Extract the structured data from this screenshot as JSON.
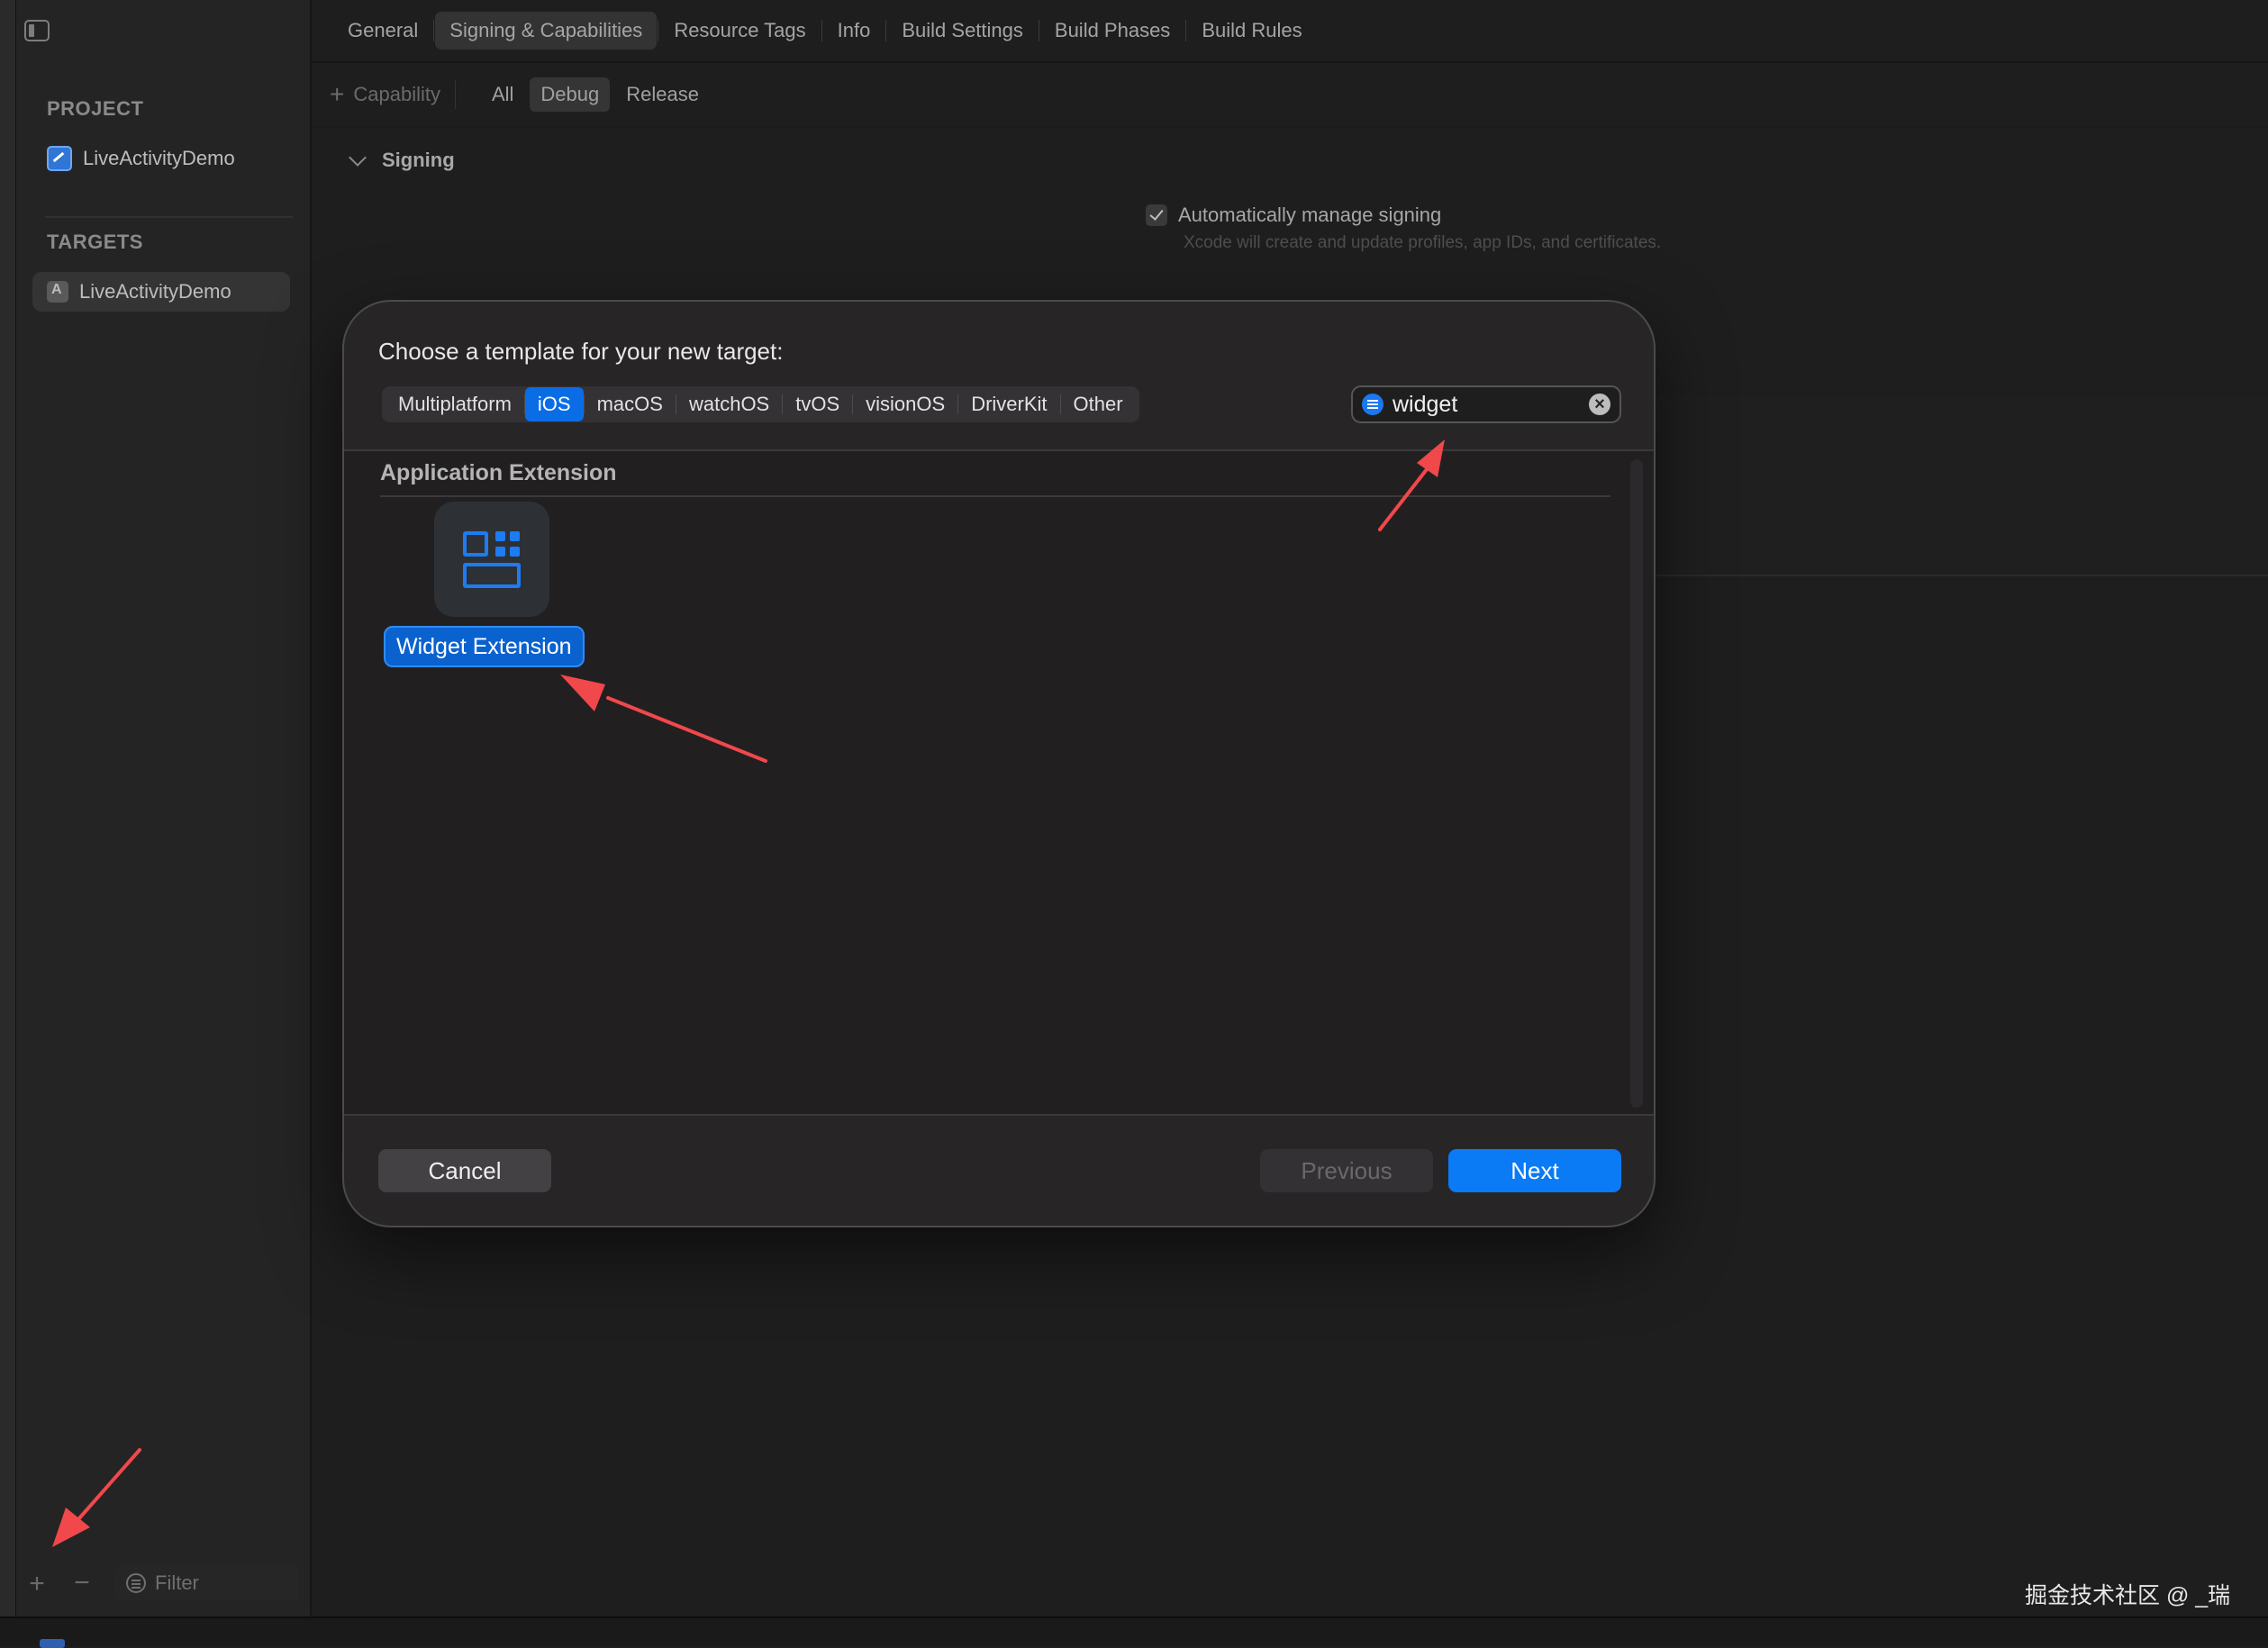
{
  "sidebar": {
    "project_heading": "PROJECT",
    "project_name": "LiveActivityDemo",
    "targets_heading": "TARGETS",
    "target_name": "LiveActivityDemo",
    "filter_placeholder": "Filter"
  },
  "top_tabs": [
    "General",
    "Signing & Capabilities",
    "Resource Tags",
    "Info",
    "Build Settings",
    "Build Phases",
    "Build Rules"
  ],
  "selected_top_tab": "Signing & Capabilities",
  "sub_bar": {
    "capability_label": "Capability",
    "configs": [
      "All",
      "Debug",
      "Release"
    ],
    "selected_config": "Debug"
  },
  "signing": {
    "header": "Signing",
    "auto_manage_label": "Automatically manage signing",
    "auto_manage_checked": true,
    "auto_manage_note": "Xcode will create and update profiles, app IDs, and certificates."
  },
  "modal": {
    "title": "Choose a template for your new target:",
    "platforms": [
      "Multiplatform",
      "iOS",
      "macOS",
      "watchOS",
      "tvOS",
      "visionOS",
      "DriverKit",
      "Other"
    ],
    "selected_platform": "iOS",
    "search_value": "widget",
    "section_title": "Application Extension",
    "template_label": "Widget Extension",
    "cancel_label": "Cancel",
    "previous_label": "Previous",
    "next_label": "Next"
  },
  "watermark": "掘金技术社区 @ _瑞",
  "colors": {
    "accent": "#0b7af5",
    "annotation_arrow": "#f0484b",
    "background": "#1e1e1e"
  }
}
